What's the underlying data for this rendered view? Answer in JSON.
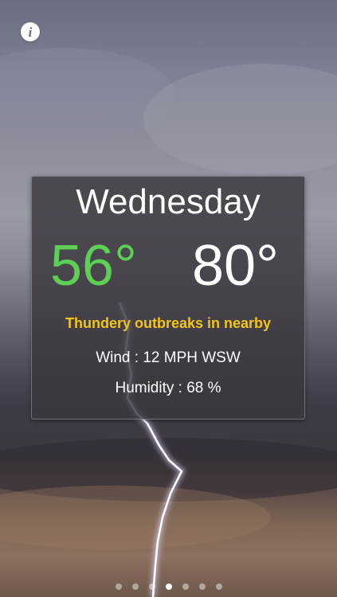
{
  "forecast": {
    "day": "Wednesday",
    "low": "56°",
    "high": "80°",
    "condition": "Thundery outbreaks in nearby",
    "wind": "Wind : 12 MPH WSW",
    "humidity": "Humidity : 68 %"
  },
  "pager": {
    "count": 7,
    "active_index": 3
  },
  "colors": {
    "low_temp": "#5ecf55",
    "high_temp": "#ffffff",
    "condition": "#f2c41c",
    "card_background": "#3a373e"
  },
  "icons": {
    "info": "info-icon"
  }
}
